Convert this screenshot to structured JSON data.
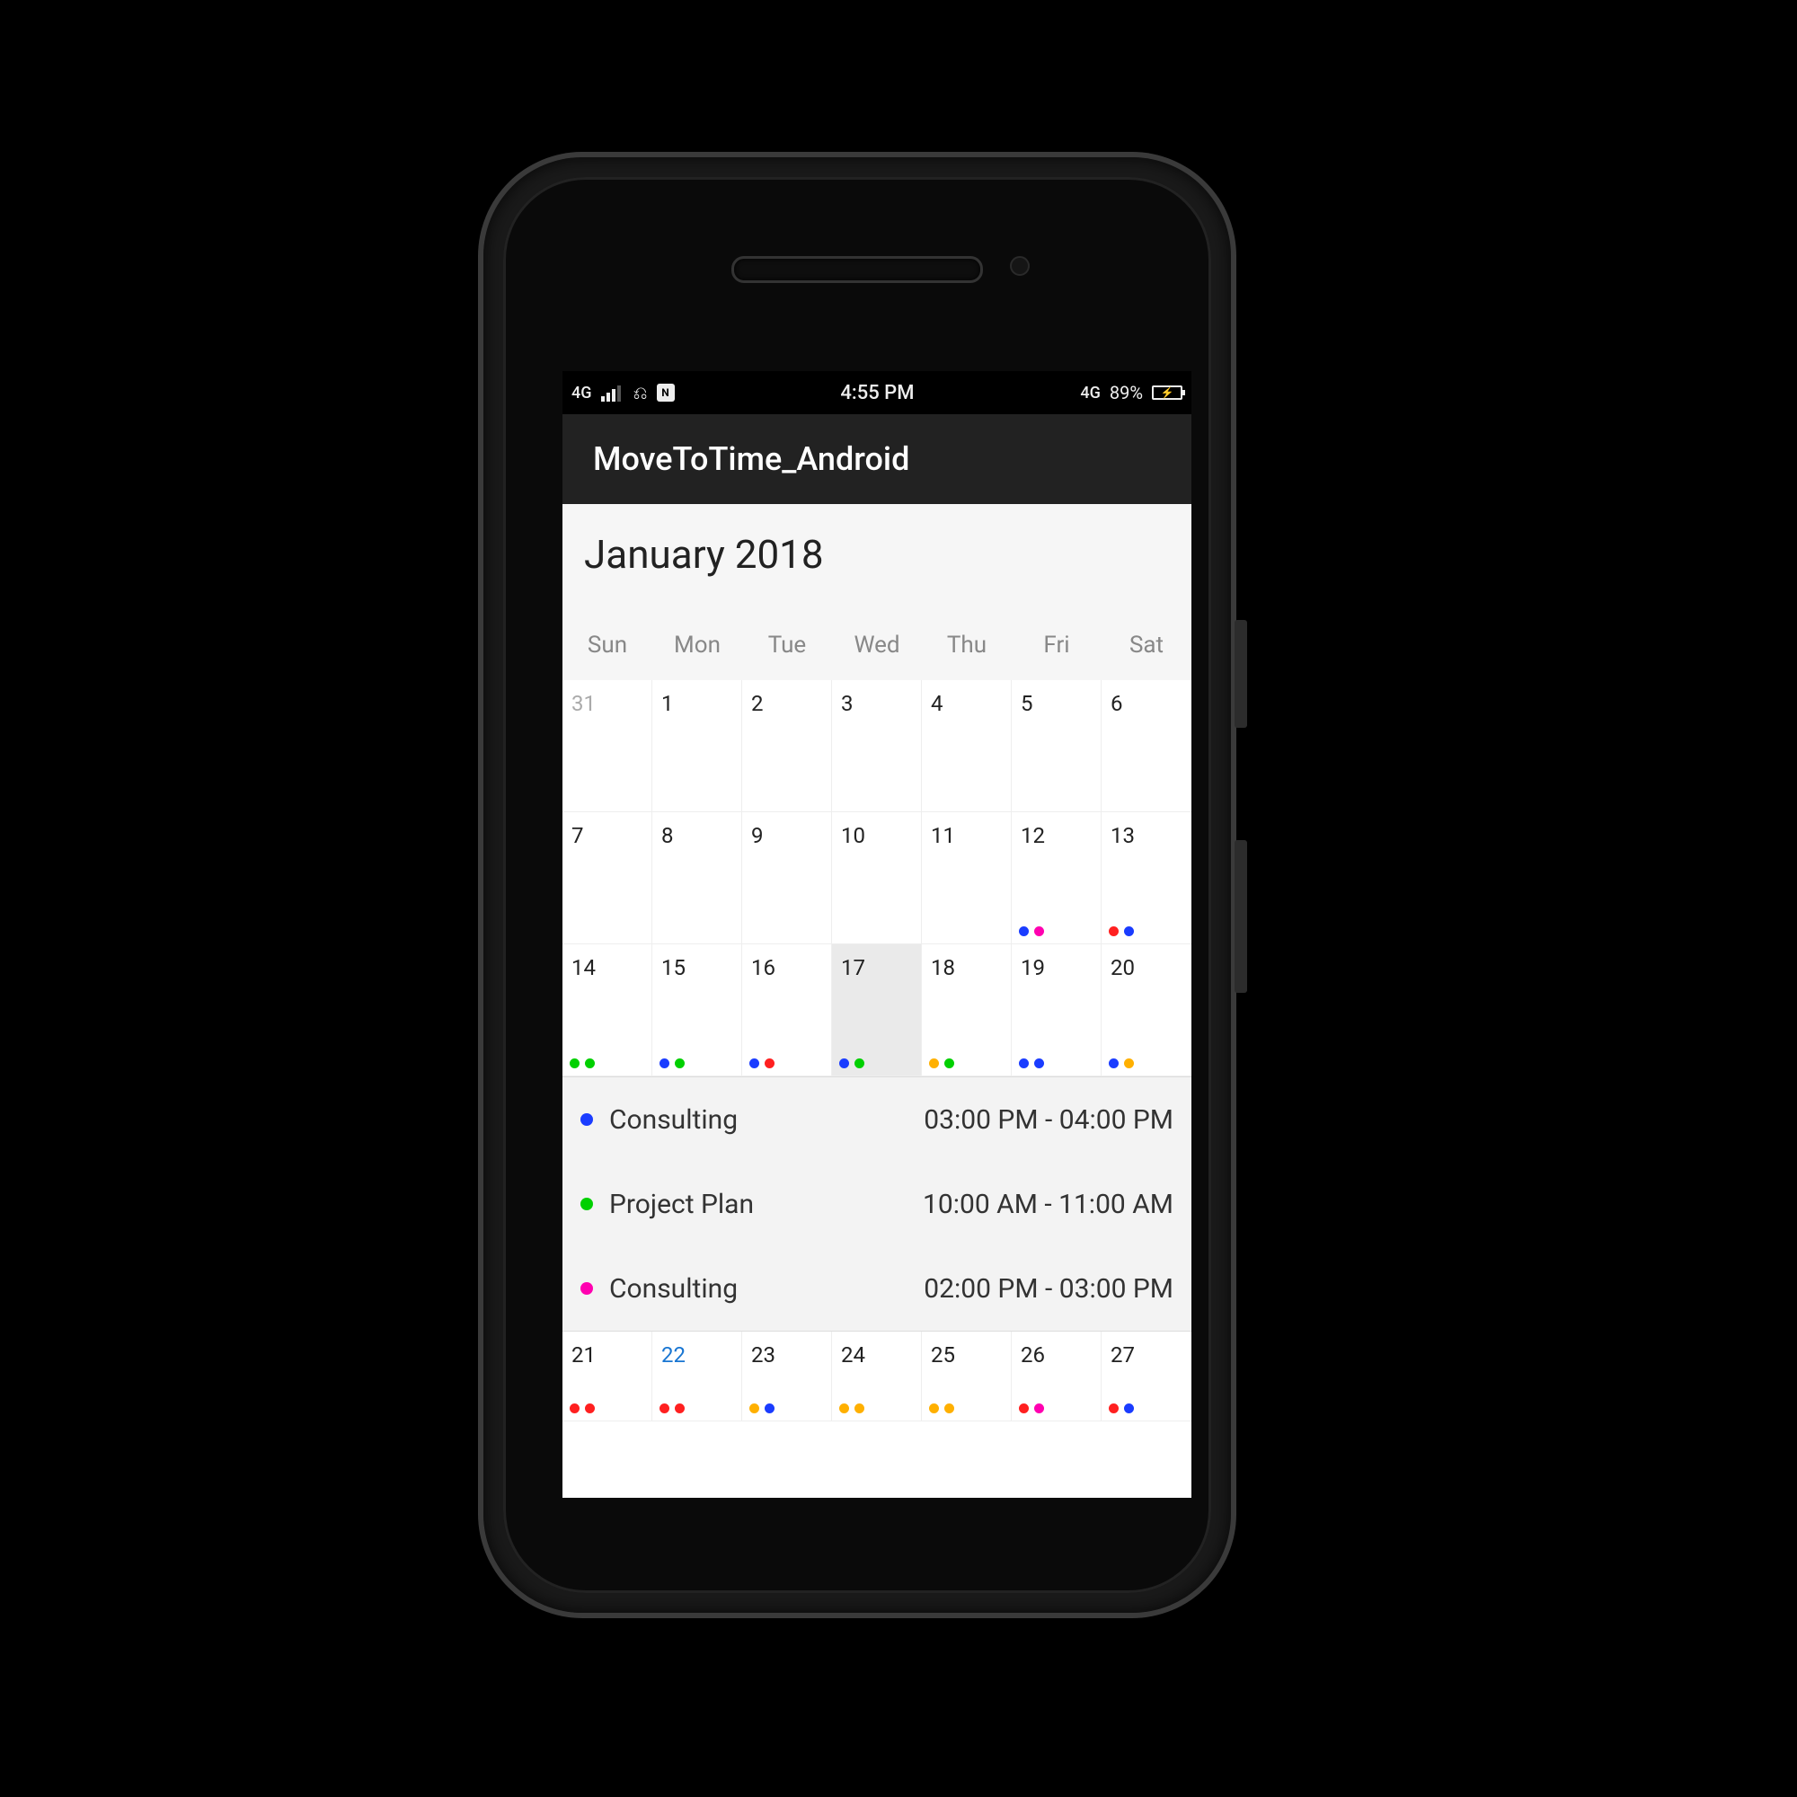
{
  "statusbar": {
    "network": "4G",
    "time": "4:55 PM",
    "net2": "4G",
    "battery_pct": "89%"
  },
  "appbar": {
    "title": "MoveToTime_Android"
  },
  "calendar": {
    "month_title": "January 2018",
    "dow": [
      "Sun",
      "Mon",
      "Tue",
      "Wed",
      "Thu",
      "Fri",
      "Sat"
    ],
    "selected_day": 17,
    "today": 22,
    "weeks": [
      [
        {
          "n": "31",
          "muted": true
        },
        {
          "n": "1"
        },
        {
          "n": "2"
        },
        {
          "n": "3"
        },
        {
          "n": "4"
        },
        {
          "n": "5"
        },
        {
          "n": "6"
        }
      ],
      [
        {
          "n": "7"
        },
        {
          "n": "8"
        },
        {
          "n": "9"
        },
        {
          "n": "10"
        },
        {
          "n": "11"
        },
        {
          "n": "12",
          "dots": [
            "#1a3cff",
            "#ff00b0"
          ]
        },
        {
          "n": "13",
          "dots": [
            "#ff2020",
            "#1a3cff"
          ]
        }
      ],
      [
        {
          "n": "14",
          "dots": [
            "#00d000",
            "#00d000"
          ]
        },
        {
          "n": "15",
          "dots": [
            "#1a3cff",
            "#00d000"
          ]
        },
        {
          "n": "16",
          "dots": [
            "#1a3cff",
            "#ff2020"
          ]
        },
        {
          "n": "17",
          "dots": [
            "#1a3cff",
            "#00d000"
          ],
          "selected": true
        },
        {
          "n": "18",
          "dots": [
            "#ffb000",
            "#00d000"
          ]
        },
        {
          "n": "19",
          "dots": [
            "#1a3cff",
            "#1a3cff"
          ]
        },
        {
          "n": "20",
          "dots": [
            "#1a3cff",
            "#ffb000"
          ]
        }
      ],
      [
        {
          "n": "21",
          "dots": [
            "#ff2020",
            "#ff2020"
          ]
        },
        {
          "n": "22",
          "dots": [
            "#ff2020",
            "#ff2020"
          ],
          "today": true
        },
        {
          "n": "23",
          "dots": [
            "#ffb000",
            "#1a3cff"
          ]
        },
        {
          "n": "24",
          "dots": [
            "#ffb000",
            "#ffb000"
          ]
        },
        {
          "n": "25",
          "dots": [
            "#ffb000",
            "#ffb000"
          ]
        },
        {
          "n": "26",
          "dots": [
            "#ff2020",
            "#ff00b0"
          ]
        },
        {
          "n": "27",
          "dots": [
            "#ff2020",
            "#1a3cff"
          ]
        }
      ]
    ]
  },
  "agenda": [
    {
      "color": "#1a3cff",
      "title": "Consulting",
      "time": "03:00 PM - 04:00 PM"
    },
    {
      "color": "#00d000",
      "title": "Project Plan",
      "time": "10:00 AM - 11:00 AM"
    },
    {
      "color": "#ff00b0",
      "title": "Consulting",
      "time": "02:00 PM - 03:00 PM"
    }
  ]
}
